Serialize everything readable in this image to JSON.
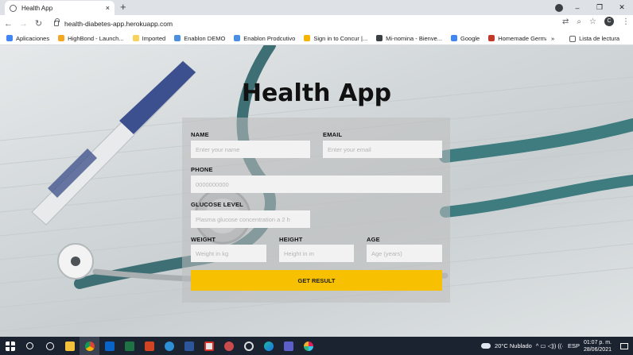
{
  "browser": {
    "tab_title": "Health App",
    "tab_close": "×",
    "new_tab": "+",
    "url": "health-diabetes-app.herokuapp.com",
    "window_controls": {
      "minimize": "–",
      "maximize": "❐",
      "close": "✕"
    },
    "profile_initial": "C",
    "icons": {
      "back": "←",
      "forward": "→",
      "reload": "↻",
      "translate": "⇄",
      "zoom": "⌕",
      "star": "☆",
      "menu": "⋮"
    }
  },
  "bookmarks": {
    "items": [
      {
        "label": "Aplicaciones",
        "color": "#4285f4"
      },
      {
        "label": "HighBond - Launch...",
        "color": "#f5a623"
      },
      {
        "label": "Imported",
        "color": "#f9d25a"
      },
      {
        "label": "Enablon DEMO",
        "color": "#4a90e2"
      },
      {
        "label": "Enablon Prodcutivo",
        "color": "#4a90e2"
      },
      {
        "label": "Sign in to Concur |...",
        "color": "#f5b400"
      },
      {
        "label": "Mi-nomina - Bienve...",
        "color": "#3c4043"
      },
      {
        "label": "Google",
        "color": "#4285f4"
      },
      {
        "label": "Homemade Germa...",
        "color": "#c0392b"
      }
    ],
    "more": "»",
    "reading_list": "Lista de lectura"
  },
  "app": {
    "title": "Health App",
    "fields": {
      "name": {
        "label": "NAME",
        "placeholder": "Enter your name"
      },
      "email": {
        "label": "EMAIL",
        "placeholder": "Enter your email"
      },
      "phone": {
        "label": "PHONE",
        "placeholder": "0000000000"
      },
      "glucose": {
        "label": "GLUCOSE LEVEL",
        "placeholder": "Plasma glucose concentration a 2 h"
      },
      "weight": {
        "label": "WEIGHT",
        "placeholder": "Weight in kg"
      },
      "height": {
        "label": "HEIGHT",
        "placeholder": "Height in m"
      },
      "age": {
        "label": "AGE",
        "placeholder": "Age (years)"
      }
    },
    "submit_label": "GET RESULT",
    "accent_color": "#f7c000"
  },
  "taskbar": {
    "weather": "20°C  Nublado",
    "language": "ESP",
    "time": "01:07 p. m.",
    "date": "28/06/2021"
  }
}
